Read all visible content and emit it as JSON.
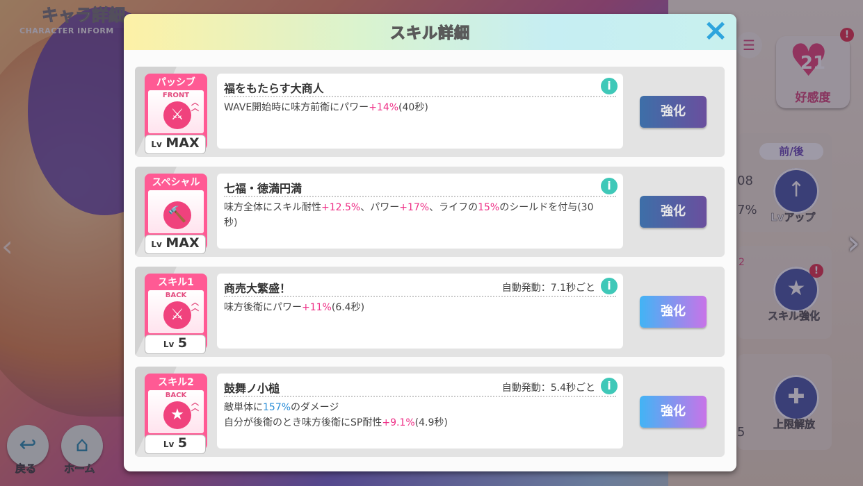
{
  "background": {
    "title": "キャラ詳細",
    "subtitle": "CHARACTER INFORM",
    "affection": {
      "value": "21",
      "label": "好感度"
    },
    "alert_mark": "!",
    "position_tag": "前/後",
    "level_up_label": "Lvアップ",
    "skill_enhance_label": "スキル強化",
    "limit_break_label": "上限解放",
    "nums": [
      "08",
      "7%",
      "5",
      "2"
    ],
    "nav": {
      "back_label": "戻る",
      "home_label": "ホーム"
    }
  },
  "modal": {
    "title": "スキル詳細",
    "close_icon": "×",
    "info_glyph": "i",
    "skills": [
      {
        "type_label": "パッシブ",
        "position": "FRONT",
        "icon": "sword-icon",
        "icon_glyph": "⚔",
        "level_prefix": "Lv",
        "level_value": "MAX",
        "name": "福をもたらす大商人",
        "auto_trigger": "",
        "desc_lines": [
          [
            {
              "t": "WAVE開始時に味方前衛にパワー"
            },
            {
              "t": "+14%",
              "c": "pink"
            },
            {
              "t": "(40秒)"
            }
          ]
        ],
        "upgrade_label": "強化",
        "upgrade_enabled": false
      },
      {
        "type_label": "スペシャル",
        "position": "",
        "icon": "mallet-icon",
        "icon_glyph": "🔨",
        "level_prefix": "Lv",
        "level_value": "MAX",
        "name": "七福・徳満円満",
        "auto_trigger": "",
        "desc_lines": [
          [
            {
              "t": "味方全体にスキル耐性"
            },
            {
              "t": "+12.5%",
              "c": "pink"
            },
            {
              "t": "、パワー"
            },
            {
              "t": "+17%",
              "c": "pink"
            },
            {
              "t": "、ライフの"
            },
            {
              "t": "15%",
              "c": "pink"
            },
            {
              "t": "のシールドを付与(30"
            }
          ],
          [
            {
              "t": "秒)"
            }
          ]
        ],
        "upgrade_label": "強化",
        "upgrade_enabled": false
      },
      {
        "type_label": "スキル1",
        "position": "BACK",
        "icon": "sword-icon",
        "icon_glyph": "⚔",
        "level_prefix": "Lv",
        "level_value": "5",
        "name": "商売大繁盛！",
        "auto_trigger": "自動発動：7.1秒ごと",
        "desc_lines": [
          [
            {
              "t": "味方後衛にパワー"
            },
            {
              "t": "+11%",
              "c": "pink"
            },
            {
              "t": "(6.4秒)"
            }
          ]
        ],
        "upgrade_label": "強化",
        "upgrade_enabled": true
      },
      {
        "type_label": "スキル2",
        "position": "BACK",
        "icon": "shield-star-icon",
        "icon_glyph": "★",
        "level_prefix": "Lv",
        "level_value": "5",
        "name": "鼓舞ノ小槌",
        "auto_trigger": "自動発動：5.4秒ごと",
        "desc_lines": [
          [
            {
              "t": "敵単体に"
            },
            {
              "t": "157%",
              "c": "blue"
            },
            {
              "t": "のダメージ"
            }
          ],
          [
            {
              "t": "自分が後衛のとき味方後衛にSP耐性"
            },
            {
              "t": "+9.1%",
              "c": "pink"
            },
            {
              "t": "(4.9秒)"
            }
          ]
        ],
        "upgrade_label": "強化",
        "upgrade_enabled": true
      }
    ]
  }
}
